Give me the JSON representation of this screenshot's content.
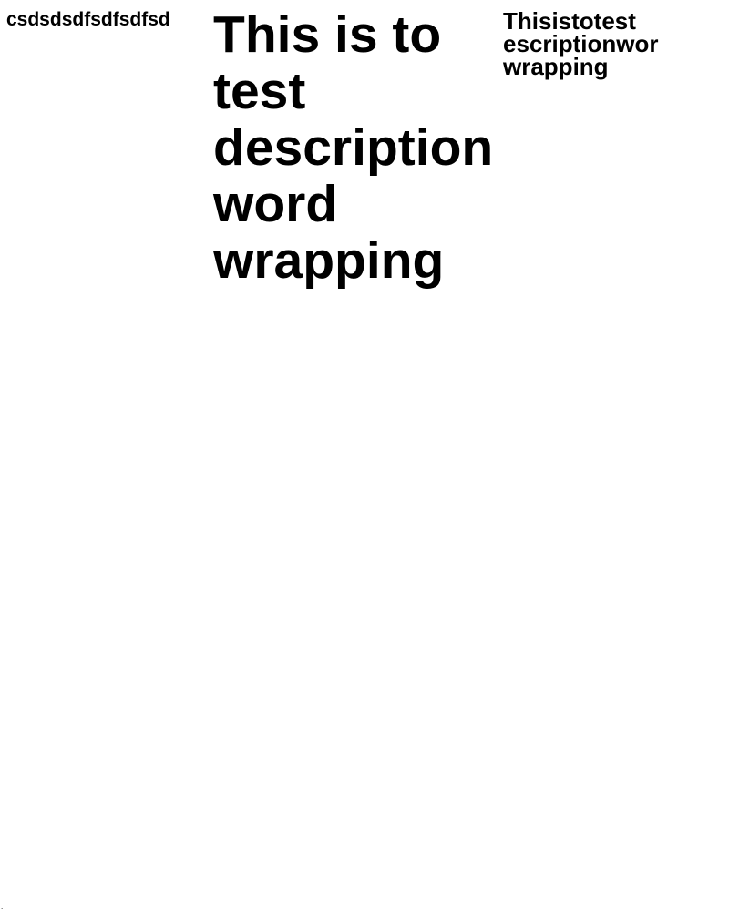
{
  "left_text": "csdsdsdfsdfsdfsd",
  "center_heading": {
    "lines": [
      "This is to",
      "test",
      "description",
      "word",
      "wrapping"
    ]
  },
  "right_text": {
    "lines": [
      "Thisistotest",
      "escriptionwor",
      "wrapping"
    ]
  },
  "corner_mark": "."
}
